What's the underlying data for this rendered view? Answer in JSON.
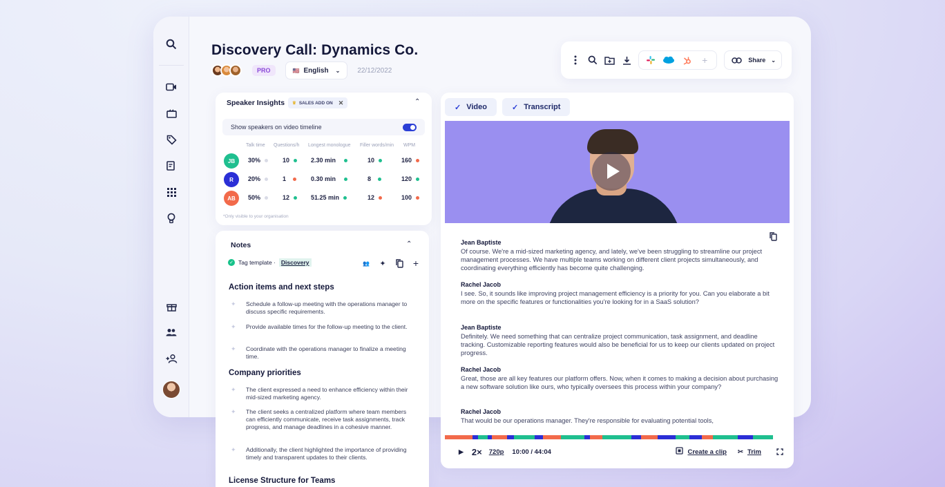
{
  "header": {
    "title": "Discovery Call: Dynamics Co.",
    "badge": "PRO",
    "language": "English",
    "language_flag": "🇺🇸",
    "date": "22/12/2022",
    "share_label": "Share"
  },
  "insights": {
    "title": "Speaker Insights",
    "addon_label": "SALES ADD ON",
    "toggle_label": "Show speakers on video timeline",
    "toggle_on": true,
    "columns": [
      "Talk time",
      "Questions/h",
      "Longest monologue",
      "Filler words/min",
      "WPM"
    ],
    "rows": [
      {
        "initials": "JB",
        "color": "#1fbf8f",
        "talk": "30%",
        "questions": "10",
        "monologue": "2.30 min",
        "filler": "10",
        "wpm": "160"
      },
      {
        "initials": "R",
        "color": "#2b2fd6",
        "talk": "20%",
        "questions": "1",
        "monologue": "0.30 min",
        "filler": "8",
        "wpm": "120"
      },
      {
        "initials": "AB",
        "color": "#f26a4b",
        "talk": "50%",
        "questions": "12",
        "monologue": "51.25 min",
        "filler": "12",
        "wpm": "100"
      }
    ],
    "footnote": "*Only visible to your organisation"
  },
  "notes": {
    "title": "Notes",
    "tag_prefix": "Tag template ·",
    "tag_name": "Discovery",
    "sections": [
      {
        "heading": "Action items and next steps",
        "items": [
          "Schedule a follow-up meeting with the operations manager to discuss specific requirements.",
          "Provide available times for the follow-up meeting to the client.",
          "Coordinate with the operations manager to finalize a meeting time."
        ]
      },
      {
        "heading": "Company priorities",
        "items": [
          "The client expressed a need to enhance efficiency within their mid-sized marketing agency.",
          "The client seeks a centralized platform where team members can efficiently communicate, receive task assignments, track progress, and manage deadlines in a cohesive manner.",
          "Additionally, the client highlighted the importance of providing timely and transparent updates to their clients."
        ]
      },
      {
        "heading": "License Structure for Teams",
        "items": []
      }
    ]
  },
  "video": {
    "tabs": [
      "Video",
      "Transcript"
    ],
    "transcript": [
      {
        "speaker": "Jean Baptiste",
        "text": "Of course. We're a mid-sized marketing agency, and lately, we've been struggling to streamline our project management processes. We have multiple teams working on different client projects simultaneously, and coordinating everything efficiently has become quite challenging."
      },
      {
        "speaker": "Rachel Jacob",
        "text": "I see. So, it sounds like improving project management efficiency is a priority for you. Can you elaborate a bit more on the specific features or functionalities you're looking for in a SaaS solution?"
      },
      {
        "speaker": "Jean Baptiste",
        "text": "Definitely. We need something that can centralize project communication, task assignment, and deadline tracking. Customizable reporting features would also be beneficial for us to keep our clients updated on project progress."
      },
      {
        "speaker": "Rachel Jacob",
        "text": "Great, those are all key features our platform offers. Now, when it comes to making a decision about purchasing a new software solution like ours, who typically oversees this process within your company?"
      },
      {
        "speaker": "Rachel Jacob",
        "text": "That would be our operations manager. They're responsible for evaluating potential tools,"
      }
    ],
    "speed": "2×",
    "quality": "720p",
    "time": "10:00 / 44:04",
    "clip_label": "Create a clip",
    "trim_label": "Trim"
  },
  "colors": {
    "accent": "#2b3fd6",
    "green": "#1fbf8f",
    "orange": "#f26a4b"
  }
}
